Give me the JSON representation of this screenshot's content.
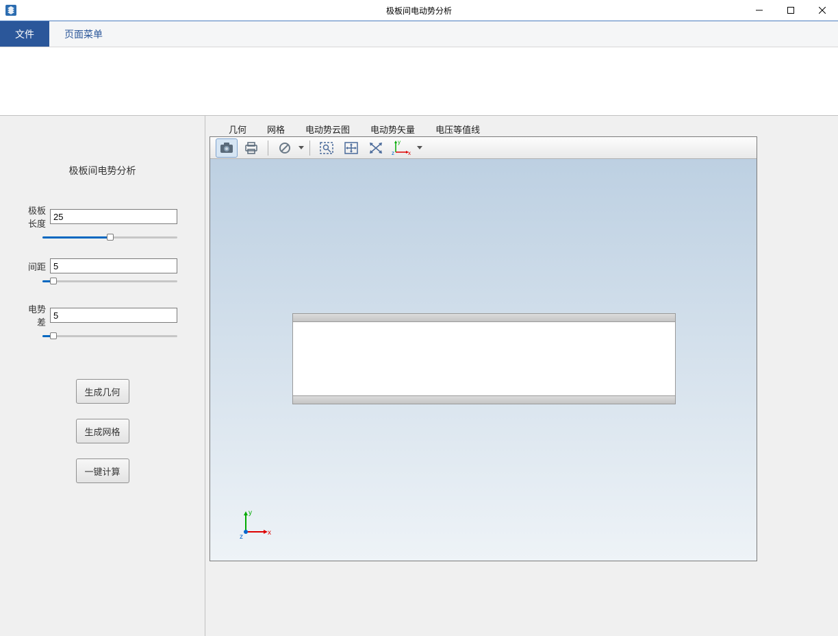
{
  "window": {
    "title": "极板间电动势分析"
  },
  "menu": {
    "file": "文件",
    "page": "页面菜单"
  },
  "sidebar": {
    "title": "极板间电势分析",
    "fields": {
      "length": {
        "label": "极板长度",
        "value": "25",
        "slider_percent": 50
      },
      "gap": {
        "label": "间距",
        "value": "5",
        "slider_percent": 8
      },
      "voltage": {
        "label": "电势差",
        "value": "5",
        "slider_percent": 8
      }
    },
    "buttons": {
      "gen_geom": "生成几何",
      "gen_mesh": "生成网格",
      "compute": "一键计算"
    }
  },
  "viewer": {
    "tabs": {
      "geom": "几何",
      "mesh": "网格",
      "cloud": "电动势云图",
      "vector": "电动势矢量",
      "contour": "电压等值线"
    },
    "toolbar_icons": {
      "camera": "camera-icon",
      "print": "print-icon",
      "forbid": "forbid-icon",
      "zoombox": "zoom-box-icon",
      "pan": "pan-icon",
      "fit": "fit-icon",
      "axes": "axes-icon"
    },
    "axis_labels": {
      "x": "x",
      "y": "y",
      "z": "z"
    }
  }
}
